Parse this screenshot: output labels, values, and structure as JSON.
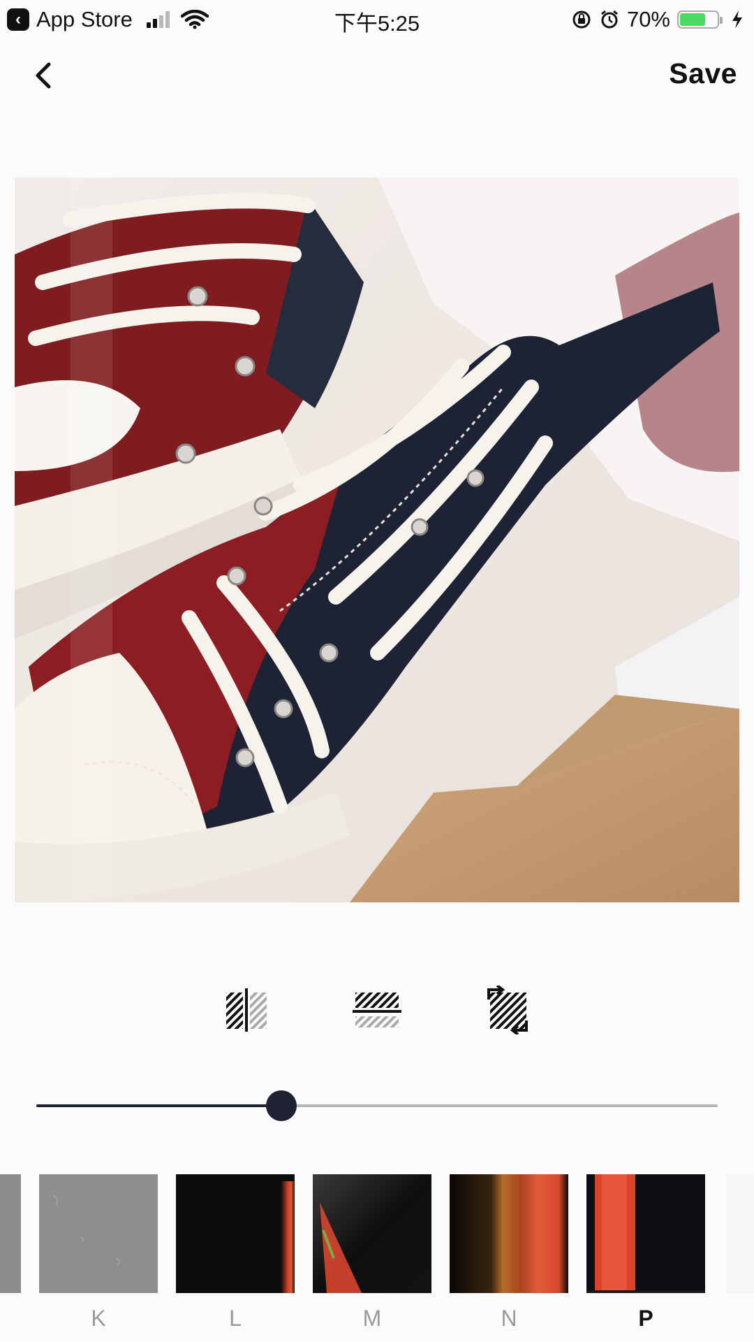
{
  "status_bar": {
    "back_app": "App Store",
    "time": "下午5:25",
    "battery_percent": "70%",
    "battery_level": 0.7,
    "icons": [
      "signal-icon",
      "wifi-icon",
      "rotation-lock-icon",
      "alarm-icon",
      "battery-icon",
      "charging-icon"
    ]
  },
  "nav": {
    "back_icon": "chevron-left-icon",
    "save_label": "Save"
  },
  "photo": {
    "subject": "red-and-navy sneakers in a shoe box"
  },
  "tools": [
    {
      "icon": "split-vertical-icon"
    },
    {
      "icon": "split-horizontal-icon"
    },
    {
      "icon": "swap-texture-icon"
    }
  ],
  "slider": {
    "value": 0.36
  },
  "filters": {
    "items": [
      {
        "label": "K",
        "selected": false
      },
      {
        "label": "L",
        "selected": false
      },
      {
        "label": "M",
        "selected": false
      },
      {
        "label": "N",
        "selected": false
      },
      {
        "label": "P",
        "selected": true
      }
    ]
  },
  "colors": {
    "accent": "#1f2233",
    "track": "#b5b5b5",
    "label_inactive": "#9a9a9a",
    "battery": "#4cd964"
  }
}
